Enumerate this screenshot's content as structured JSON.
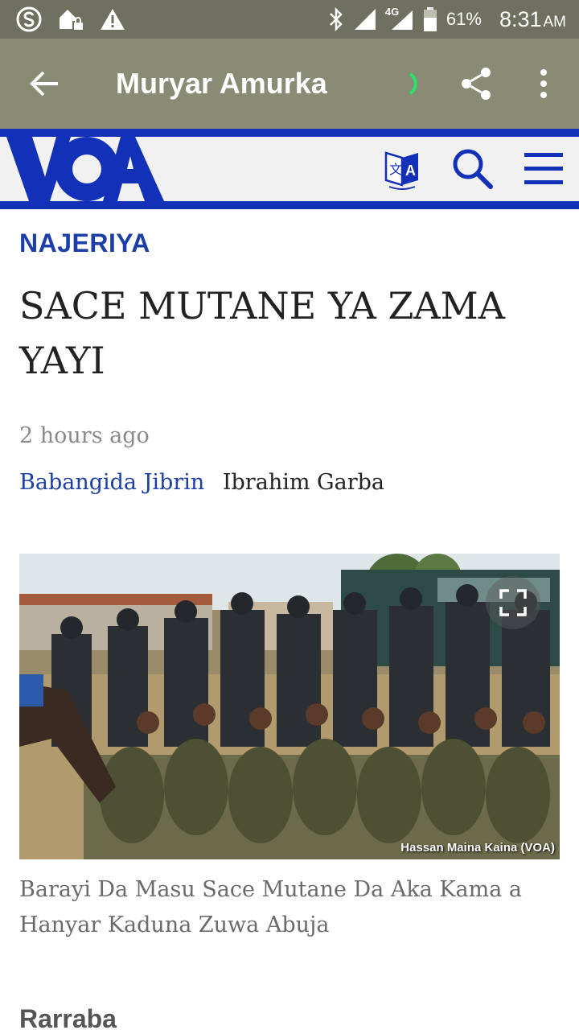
{
  "status_bar": {
    "battery_percent": "61%",
    "network": "4G",
    "time": "8:31",
    "ampm": "AM",
    "icons": [
      "skype-icon",
      "app-lock-icon",
      "warning-icon",
      "bluetooth-icon",
      "signal-icon",
      "battery-icon"
    ]
  },
  "app_bar": {
    "title": "Muryar Amurka",
    "icons": [
      "back-arrow-icon",
      "loading-spinner-icon",
      "share-icon",
      "more-vert-icon"
    ]
  },
  "voa_header": {
    "logo_text": "VOA",
    "brand_color": "#1330b8",
    "icons": [
      "translate-icon",
      "search-icon",
      "menu-icon"
    ]
  },
  "article": {
    "section": "NAJERIYA",
    "headline": "SACE MUTANE YA ZAMA YAYI",
    "timestamp": "2 hours ago",
    "author_link": "Babangida Jibrin",
    "author_plain": "Ibrahim Garba",
    "photo_credit": "Hassan Maina Kaina (VOA)",
    "caption": "Barayi Da Masu Sace Mutane Da Aka Kama a Hanyar Kaduna Zuwa Abuja",
    "next_section": "Rarraba"
  },
  "colors": {
    "status_bar": "#6f705f",
    "app_bar": "#8a8b74",
    "link_blue": "#1c3fa7"
  }
}
